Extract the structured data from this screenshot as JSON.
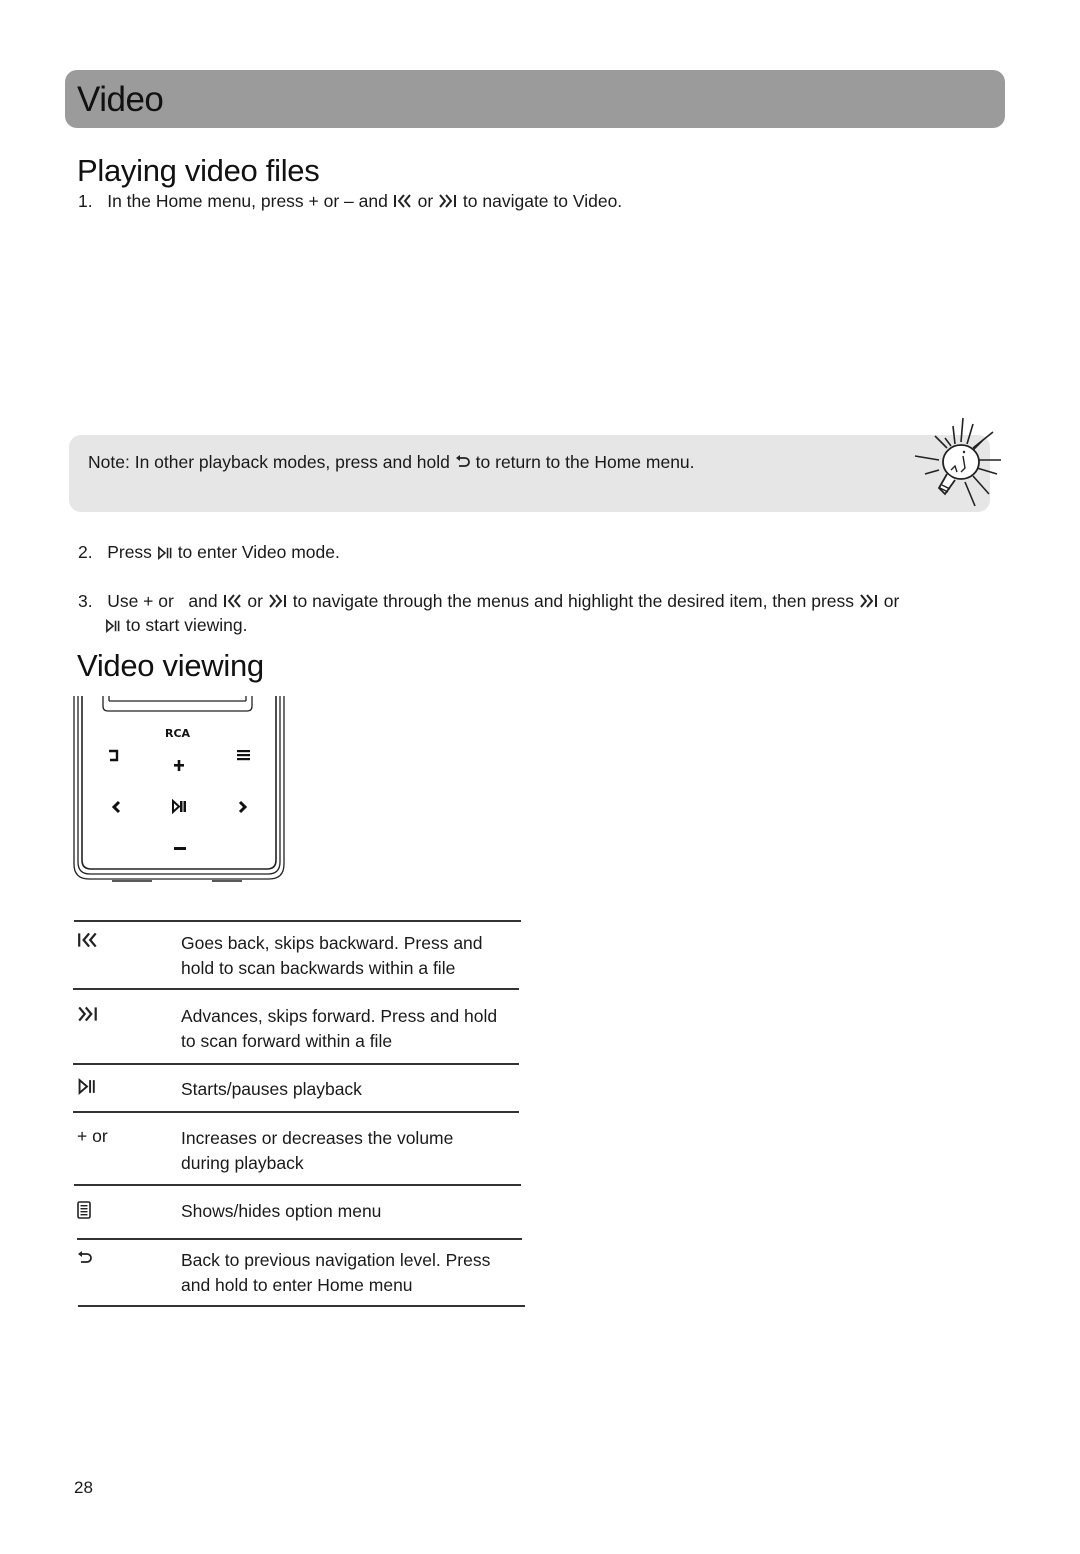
{
  "section": {
    "title": "Video"
  },
  "playing": {
    "heading": "Playing video files",
    "step1": {
      "num": "1.",
      "a": "In the Home menu, press + or – and",
      "b": "or",
      "c": "to navigate to Video."
    },
    "note": {
      "label": "Note:",
      "a": "In other playback modes, press and hold",
      "b": "to return to the Home menu."
    },
    "step2": {
      "num": "2.",
      "a": "Press",
      "b": "to enter Video mode."
    },
    "step3": {
      "num": "3.",
      "a": "Use + or",
      "b": "and",
      "c": "or",
      "d": "to navigate through the menus and highlight the desired item, then press",
      "e": "or",
      "f": "to start viewing."
    }
  },
  "viewing": {
    "heading": "Video viewing",
    "device": {
      "brand": "RCA"
    },
    "controls": [
      {
        "icon": "skip-back-icon",
        "key": "",
        "desc": [
          "Goes back, skips backward. Press and",
          "hold to scan backwards within a file"
        ]
      },
      {
        "icon": "skip-forward-icon",
        "key": "",
        "desc": [
          "Advances, skips forward. Press and hold",
          "to scan forward within a file"
        ]
      },
      {
        "icon": "play-pause-icon",
        "key": "",
        "desc": [
          "Starts/pauses playback"
        ]
      },
      {
        "icon": "",
        "key": "+ or",
        "desc": [
          "Increases or decreases the volume",
          "during playback"
        ]
      },
      {
        "icon": "option-menu-icon",
        "key": "",
        "desc": [
          "Shows/hides option menu"
        ]
      },
      {
        "icon": "back-icon",
        "key": "",
        "desc": [
          "Back to previous navigation level. Press",
          "and hold to enter Home menu"
        ]
      }
    ]
  },
  "footer": {
    "page_number": "28"
  }
}
